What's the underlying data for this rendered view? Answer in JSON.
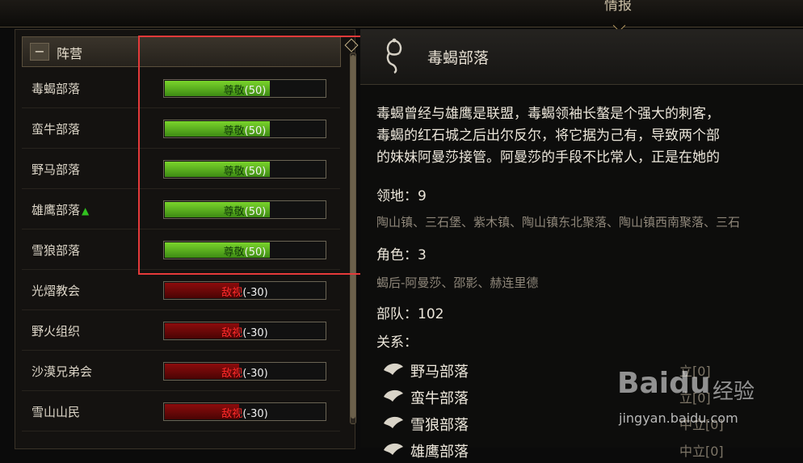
{
  "top": {
    "title": "情报"
  },
  "left": {
    "group_title": "阵营",
    "collapse_symbol": "−",
    "rows": [
      {
        "name": "毒蝎部落",
        "status": "尊敬",
        "value": "(50)",
        "tone": "green",
        "arrow": ""
      },
      {
        "name": "蛮牛部落",
        "status": "尊敬",
        "value": "(50)",
        "tone": "green",
        "arrow": ""
      },
      {
        "name": "野马部落",
        "status": "尊敬",
        "value": "(50)",
        "tone": "green",
        "arrow": ""
      },
      {
        "name": "雄鹰部落",
        "status": "尊敬",
        "value": "(50)",
        "tone": "green",
        "arrow": "▲"
      },
      {
        "name": "雪狼部落",
        "status": "尊敬",
        "value": "(50)",
        "tone": "green",
        "arrow": ""
      },
      {
        "name": "光熠教会",
        "status": "敌视",
        "value": "(-30)",
        "tone": "red",
        "arrow": ""
      },
      {
        "name": "野火组织",
        "status": "敌视",
        "value": "(-30)",
        "tone": "red",
        "arrow": ""
      },
      {
        "name": "沙漠兄弟会",
        "status": "敌视",
        "value": "(-30)",
        "tone": "red",
        "arrow": ""
      },
      {
        "name": "雪山山民",
        "status": "敌视",
        "value": "(-30)",
        "tone": "red",
        "arrow": ""
      }
    ],
    "colors": {
      "green_fill": "#5fb821",
      "red_fill": "#7a0909",
      "highlight": "#e53a3a"
    }
  },
  "right": {
    "faction_name": "毒蝎部落",
    "description": [
      "毒蝎曾经与雄鹰是联盟，毒蝎领袖长螯是个强大的刺客，",
      "毒蝎的红石城之后出尔反尔，将它据为己有，导致两个部",
      "的妹妹阿曼莎接管。阿曼莎的手段不比常人，正是在她的"
    ],
    "territory_label": "领地：9",
    "territory_list": "陶山镇、三石堡、紫木镇、陶山镇东北聚落、陶山镇西南聚落、三石",
    "roles_label": "角色：3",
    "roles_list": "蝎后-阿曼莎、邵影、赫连里德",
    "troops_label": "部队：102",
    "relations_label": "关系：",
    "relations": [
      {
        "name": "野马部落",
        "status": "立[0]"
      },
      {
        "name": "蛮牛部落",
        "status": "立[0]"
      },
      {
        "name": "雪狼部落",
        "status": "中立[0]"
      },
      {
        "name": "雄鹰部落",
        "status": "中立[0]"
      }
    ]
  },
  "watermark": {
    "brand": "Baidu",
    "cn": "经验",
    "url": "jingyan.baidu.com"
  }
}
